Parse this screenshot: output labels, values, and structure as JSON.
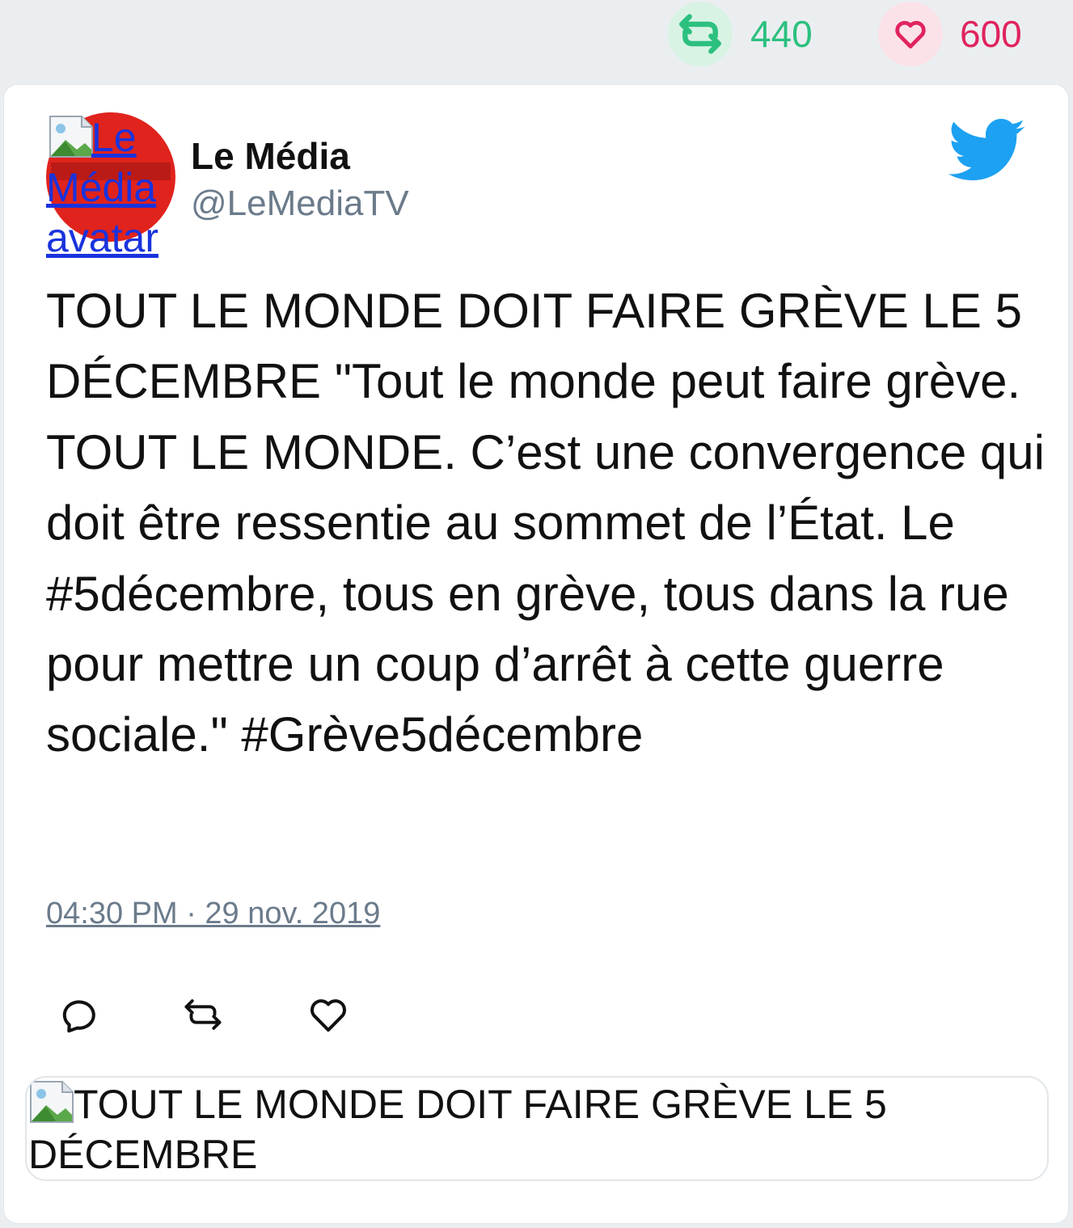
{
  "stats": {
    "retweet_count": "440",
    "like_count": "600"
  },
  "colors": {
    "retweet": "#2cc07f",
    "like": "#e0245e",
    "twitter_blue": "#1da1f2"
  },
  "author": {
    "name": "Le Média",
    "handle": "@LeMediaTV",
    "avatar_alt": "Le Média avatar"
  },
  "tweet": {
    "text": "TOUT LE MONDE DOIT FAIRE GRÈVE LE 5 DÉCEMBRE \"Tout le monde peut faire grève. TOUT LE MONDE. C’est une convergence qui doit être ressentie au sommet de l’État. Le #5décembre, tous en grève, tous dans la rue pour mettre un coup d’arrêt à cette guerre sociale.\" #Grève5décembre",
    "timestamp": "04:30 PM · 29 nov. 2019"
  },
  "preview": {
    "alt": "TOUT LE MONDE DOIT FAIRE GRÈVE LE 5 DÉCEMBRE"
  },
  "icons": {
    "retweet": "retweet-icon",
    "like": "heart-icon",
    "reply": "reply-icon",
    "brand": "twitter-bird-icon"
  }
}
